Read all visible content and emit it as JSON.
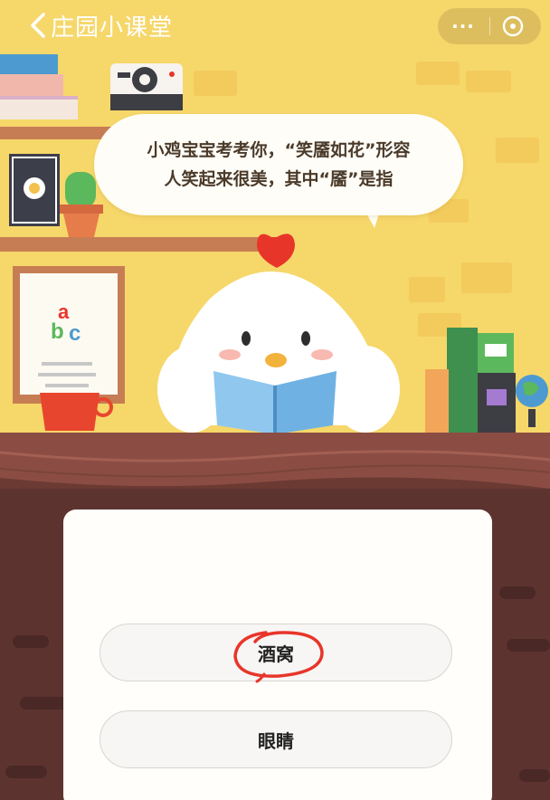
{
  "header": {
    "title": "庄园小课堂",
    "more_label": "···"
  },
  "question": {
    "line1": "小鸡宝宝考考你，“笑靥如花”形容",
    "line2": "人笑起来很美，其中“靥”是指"
  },
  "blackboard": {
    "letters": [
      "a",
      "b",
      "c"
    ]
  },
  "options": [
    {
      "label": "酒窝",
      "circled": true
    },
    {
      "label": "眼睛",
      "circled": false
    }
  ],
  "colors": {
    "background": "#f6d76a",
    "table": "#6b3a33",
    "card": "#fffefb",
    "annotation": "#e8352a"
  }
}
